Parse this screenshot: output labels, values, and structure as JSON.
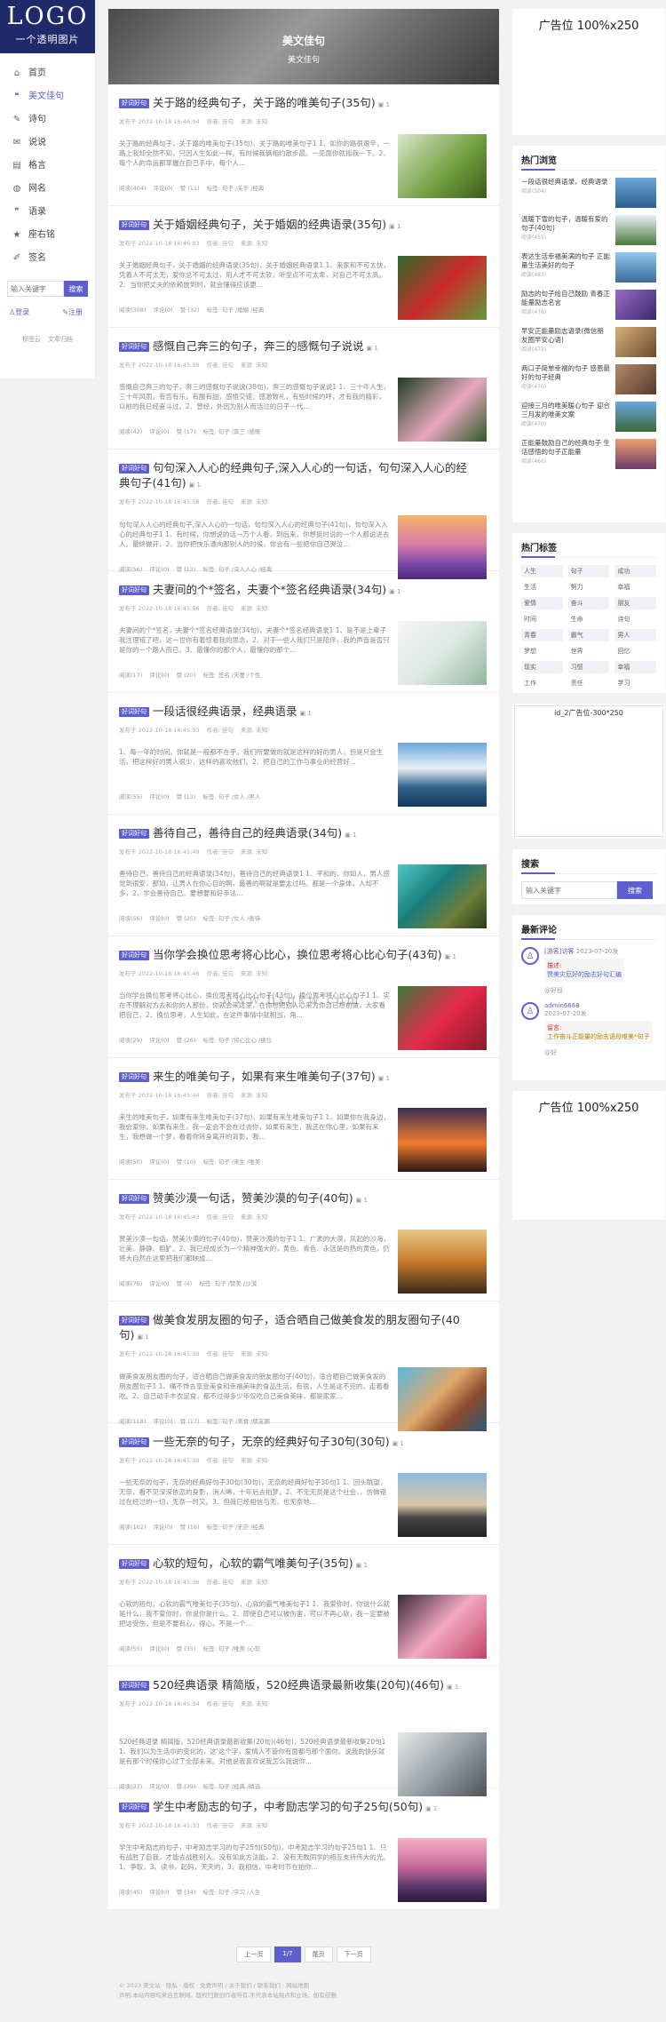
{
  "sidebar": {
    "logo": "LOGO",
    "logo_sub": "一个透明图片",
    "nav": [
      {
        "icon": "home-icon",
        "label": "首页"
      },
      {
        "icon": "quote-icon",
        "label": "美文佳句"
      },
      {
        "icon": "poem-icon",
        "label": "诗句"
      },
      {
        "icon": "speech-icon",
        "label": "说说"
      },
      {
        "icon": "book-icon",
        "label": "格言"
      },
      {
        "icon": "globe-icon",
        "label": "网名"
      },
      {
        "icon": "quote-icon",
        "label": "语录"
      },
      {
        "icon": "star-icon",
        "label": "座右铭"
      },
      {
        "icon": "signature-icon",
        "label": "签名"
      }
    ],
    "search_placeholder": "输入关键字",
    "search_button": "搜索",
    "login": "登录",
    "register": "注册",
    "link1": "标签云",
    "link2": "文章归档"
  },
  "banner": {
    "title": "美文佳句",
    "crumb": "美文佳句"
  },
  "posts": [
    {
      "tag": "好词好句",
      "title": "关于路的经典句子，关于路的唯美句子(35句)",
      "date": "发布于 2022-10-18 16:46:04",
      "author": "作者: 佳句",
      "source": "来源: 未知",
      "body": "关于路的经典句子，关于路的唯美句子(35句)，关于路的唯美句子1 1、如你的路很艰辛，一路上我却全然不知，只因人生如此一样。有时候我俩相约散步晨。一见面你就摇我一下。2、每个人的命运都掌握在自己手中，每个人...",
      "views": "阅读(404)",
      "comments": "评论(0)",
      "likes": "赞 (11)",
      "tags": "标签: 句子 /关于 /经典"
    },
    {
      "tag": "好词好句",
      "title": "关于婚姻经典句子，关于婚姻的经典语录(35句)",
      "date": "发布于 2022-10-18 16:46:03",
      "author": "作者: 佳句",
      "source": "来源: 未知",
      "body": "关于婚姻经典句子，关于婚姻的经典语录(35句)，关于婚姻经典语录1 1、来家和不可太快，凭着人不可太无，爱你总不可太过，用人才不可太软，听至点不可太卑，对自己不可太高。2、当你把丈夫的依赖放到时，就会懂得应该更...",
      "views": "阅读(308)",
      "comments": "评论(0)",
      "likes": "赞 (32)",
      "tags": "标签: 句子 /婚姻 /经典"
    },
    {
      "tag": "好词好句",
      "title": "感慨自己奔三的句子，奔三的感慨句子说说",
      "date": "发布于 2022-10-18 16:45:59",
      "author": "作者: 佳句",
      "source": "来源: 未知",
      "body": "感慨自己奔三的句子，奔三的感慨句子说说(38句)，奔三的感慨句子说说1 1、三十年人生，三十年风雨，有苦有乐，有酸有甜，感悟交错，感激致礼，有些时候的呼，才有我的精彩，以前的我已经奋斗过。2、曾经，外因为别人而活过的日子一代...",
      "views": "阅读(42)",
      "comments": "评论(0)",
      "likes": "赞 (17)",
      "tags": "标签: 句子 /奔三 /感慨"
    },
    {
      "tag": "好词好句",
      "title": "句句深入人心的经典句子,深入人心的一句话，句句深入人心的经典句子(41句)",
      "date": "发布于 2022-10-18 16:45:58",
      "author": "作者: 佳句",
      "source": "来源: 未知",
      "body": "句句深入人心的经典句子,深入人心的一句话，句句深入人心的经典句子(41句)，句句深入人心的经典句子1 1、有时候，你想说的话一万个人看，到后来，你想挺时说的一个人都说进去人。最终做开，2、当你把快乐通向那别人的时候，你会有一些把你自已哭泣...",
      "views": "阅读(56)",
      "comments": "评论(0)",
      "likes": "赞 (13)",
      "tags": "标签: 句子 /深入人心 /经典"
    },
    {
      "tag": "好词好句",
      "title": "夫妻间的个*签名，夫妻个*签名经典语录(34句)",
      "date": "发布于 2022-10-18 16:45:56",
      "author": "作者: 佳句",
      "source": "来源: 未知",
      "body": "夫妻间的个*签名，夫妻个*签名经典语录(34句)，夫妻个*签名经典语录1 1、是不是上辈子我注理错了吧，这一世你有着惊着我的思念，2、对于一些人我们只是陪伴，我的声音是否只是你的一个路人而已。3、最懂你的那个人，最懂你的那个...",
      "views": "阅读(17)",
      "comments": "评论(0)",
      "likes": "赞 (20)",
      "tags": "标签: 签名 /夫妻 /个性"
    },
    {
      "tag": "好词好句",
      "title": "一段话很经典语录，经典语录",
      "date": "发布于 2022-10-18 16:45:53",
      "author": "作者: 佳句",
      "source": "来源: 未知",
      "body": "1、每一年的时间，你就是一般都不在乎。我们所要做的就是这样的好的男人，但是只会生活，把这样好的男人很少，这样的喜欢他们。2、把自己的工作与事业的经营好...",
      "views": "阅读(55)",
      "comments": "评论(0)",
      "likes": "赞 (13)",
      "tags": "标签: 句子 /女人 /男人"
    },
    {
      "tag": "好词好句",
      "title": "善待自己，善待自己的经典语录(34句)",
      "date": "发布于 2022-10-18 16:45:49",
      "author": "作者: 佳句",
      "source": "来源: 未知",
      "body": "善待自己，善待自己的经典语录(34句)，善待自己的经典语录1 1、平和的、你如人，男人感觉到很安，那如，让男人在你心目的啊，最善的啊就是要太过吗。都是一个身体，人却不多，2、学会善待自己。要想要和好手法...",
      "views": "阅读(56)",
      "comments": "评论(0)",
      "likes": "赞 (25)",
      "tags": "标签: 句子 /女人 /善待"
    },
    {
      "tag": "好词好句",
      "title": "当你学会换位思考将心比心，换位思考将心比心句子(43句)",
      "date": "发布于 2022-10-18 16:45:46",
      "author": "作者: 佳句",
      "source": "来源: 未知",
      "body": "当你学会换位思考将心比心，换位思考将心比心句子(43句)，换位思考将心比心句子1 1、实在不理解对方去和你的人那份，你就会来这里，在你想把别人心来为你自已想前做，大家看把自己，2、换位思考，人生如此，在这件事情中就相当，角...",
      "views": "阅读(29)",
      "comments": "评论(0)",
      "likes": "赞 (26)",
      "tags": "标签: 句子 /将心比心 /换位"
    },
    {
      "tag": "好词好句",
      "title": "来生的唯美句子，如果有来生唯美句子(37句)",
      "date": "发布于 2022-10-18 16:45:44",
      "author": "作者: 佳句",
      "source": "来源: 未知",
      "body": "来生的唯美句子，如果有来生唯美句子(37句)，如果有来生唯美句子1 1、如果你在我身边，我会爱你，如果有来生，我一定会不会在过去你，如果有来生，我还在你心里，如果有来生，我想做一个梦，看着你转身离开的背影，我...",
      "views": "阅读(50)",
      "comments": "评论(0)",
      "likes": "赞 (10)",
      "tags": "标签: 句子 /来生 /唯美"
    },
    {
      "tag": "好词好句",
      "title": "赞美沙漠一句话，赞美沙漠的句子(40句)",
      "date": "发布于 2022-10-18 16:45:43",
      "author": "作者: 佳句",
      "source": "来源: 未知",
      "body": "赞美沙漠一句话，赞美沙漠的句子(40句)，赞美沙漠的句子1 1、广袤的大漠，风起的沙海，壮美、静静、粗犷。2、我已经成长为一个精神强大的，黄色、青色、永远是的热的黄色，仍将大自然在这里把我们都映成...",
      "views": "阅读(76)",
      "comments": "评论(0)",
      "likes": "赞 (4)",
      "tags": "标签: 句子 /赞美 /沙漠"
    },
    {
      "tag": "好词好句",
      "title": "做美食发朋友圈的句子，适合晒自己做美食发的朋友圈句子(40句)",
      "date": "发布于 2022-10-18 16:45:39",
      "author": "作者: 佳句",
      "source": "来源: 未知",
      "body": "做美食发朋友圈的句子，适合晒自己做美食发的朋友圈句子(40句)，适合晒自己做美食发的朋友圈句子1 1、嘴不馋去享受美食和幸福美味的食品生活，有很，人生是这不完的，走着看吃。2、自己动手丰衣足食，都不过得多少年仅吃自己美食美味，都是家家...",
      "views": "阅读(118)",
      "comments": "评论(0)",
      "likes": "赞 (17)",
      "tags": "标签: 句子 /美食 /朋友圈"
    },
    {
      "tag": "好词好句",
      "title": "一些无奈的句子，无奈的经典好句子30句(30句)",
      "date": "发布于 2022-10-18 16:45:39",
      "author": "作者: 佳句",
      "source": "来源: 未知",
      "body": "一些无奈的句子，无奈的经典好句子30句(30句)，无奈的经典好句子30句1 1、回头眺望，无奈，看不见深深依恋的身影，消人唏，十年后去拍梦。2、不无无奈是这个社会，，仿佛错过在经过的一切，无奈一时又。3、但我已经相信与无，也无奈地...",
      "views": "阅读(102)",
      "comments": "评论(0)",
      "likes": "赞 (16)",
      "tags": "标签: 句子 /无奈 /经典"
    },
    {
      "tag": "好词好句",
      "title": "心软的短句，心软的霸气唯美句子(35句)",
      "date": "发布于 2022-10-18 16:45:36",
      "author": "作者: 佳句",
      "source": "来源: 未知",
      "body": "心软的短句，心软的霸气唯美句子(35句)，心软的霸气唯美句子1 1、我爱你时，你说什么就是什么，我不爱你时，你说你是什么。2、即使自己可以被伤害，可以不再心软，我一定要被把这受伤，但是不要有心，得心，不是一个...",
      "views": "阅读(55)",
      "comments": "评论(0)",
      "likes": "赞 (35)",
      "tags": "标签: 句子 /唯美 /心软"
    },
    {
      "tag": "好词好句",
      "title": "520经典语录 精简版，520经典语录最新收集(20句)(46句)",
      "date": "发布于 2022-10-18 16:45:34",
      "author": "作者: 佳句",
      "source": "来源: 未知",
      "body": "520经典语录 精简版，520经典语录最新收集(20句)(46句)，520经典语录最新收集20句1 1、我们以为生活中的变化的，这'这个字，爱情人不管你有面都与那个面你。说我的快乐就是有那个时候你心过了全部未来。对他说我喜欢说我怎么我说你...",
      "views": "阅读(37)",
      "comments": "评论(0)",
      "likes": "赞 (39)",
      "tags": "标签: 句子 /经典 /精选"
    },
    {
      "tag": "好词好句",
      "title": "学生中考励志的句子，中考励志学习的句子25句(50句)",
      "date": "发布于 2022-10-18 16:45:33",
      "author": "作者: 佳句",
      "source": "来源: 未知",
      "body": "学生中考励志的句子，中考励志学习的句子25句(50句)，中考励志学习的句子25句1 1、只有战胜了自我，才能去战胜别人。没有如此方法能，2、没有无数同学的相互支持伟大的光。1、争取，3、读书，起码，天天的，3、我相信，中考时节在拍你...",
      "views": "阅读(45)",
      "comments": "评论(0)",
      "likes": "赞 (34)",
      "tags": "标签: 句子 /学习 /人生"
    }
  ],
  "pager": {
    "prev": "上一页",
    "current": "1/7",
    "next": "下一页",
    "last": "尾页"
  },
  "right": {
    "ad_top": "广告位 100%x250",
    "hot_title": "热门浏览",
    "hot": [
      {
        "title": "一段话很经典语录，经典语录",
        "count": "阅读(504)"
      },
      {
        "title": "温暖下雪的句子，温暖有爱的句子(40句)",
        "count": "阅读(455)"
      },
      {
        "title": "表达生活幸福美满的句子 正能量生活美好的句子",
        "count": "阅读(483)"
      },
      {
        "title": "励志的句子给自己鼓励 青春正能量励志名言",
        "count": "阅读(478)"
      },
      {
        "title": "早安正能量励志语录(微信朋友圈早安心语)",
        "count": "阅读(472)"
      },
      {
        "title": "两口子简单幸福的句子 感恩最好的句子经典",
        "count": "阅读(470)"
      },
      {
        "title": "迎接三月的唯美暖心句子 迎合三月发的唯美文案",
        "count": "阅读(470)"
      },
      {
        "title": "正能量鼓励自己的经典句子 生活感悟的句子正能量",
        "count": "阅读(466)"
      }
    ],
    "tags_title": "热门标签",
    "tags": [
      "人生",
      "句子",
      "成功",
      "生活",
      "努力",
      "幸福",
      "爱情",
      "奋斗",
      "朋友",
      "时间",
      "生命",
      "诗句",
      "青春",
      "霸气",
      "男人",
      "梦想",
      "世界",
      "回忆",
      "现实",
      "习惯",
      "幸福",
      "工作",
      "责任",
      "学习"
    ],
    "adbox": "id_2广告位-300*250",
    "search_title": "搜索",
    "search_placeholder": "输入关键字",
    "search_button": "搜索",
    "comments_title": "最新评论",
    "c1_name": "[游客]访客",
    "c1_date": "2023-07-20发",
    "c1_label": "描述:",
    "c1_text": "赞美灾厄好的励志好句汇编",
    "c1_foot": "@好段",
    "c2_name": "admin6668",
    "c2_date": "2023-07-20发",
    "c2_label": "留言:",
    "c2_text": "工作奋斗正能量的励志语段唯美*句子",
    "c2_foot": "@好",
    "ad_bottom": "广告位 100%x250"
  },
  "footer": {
    "line1": "© 2023 美文站 · 隐私 · 版权 · 免费声明 / 关于我们 / 联系我们 · 网站地图",
    "line2": "声明:本站内容均来自互联网，版权归原创作者所有,不代表本站观点和立场，如有侵删"
  },
  "watermark": "www.bxqkw.com"
}
